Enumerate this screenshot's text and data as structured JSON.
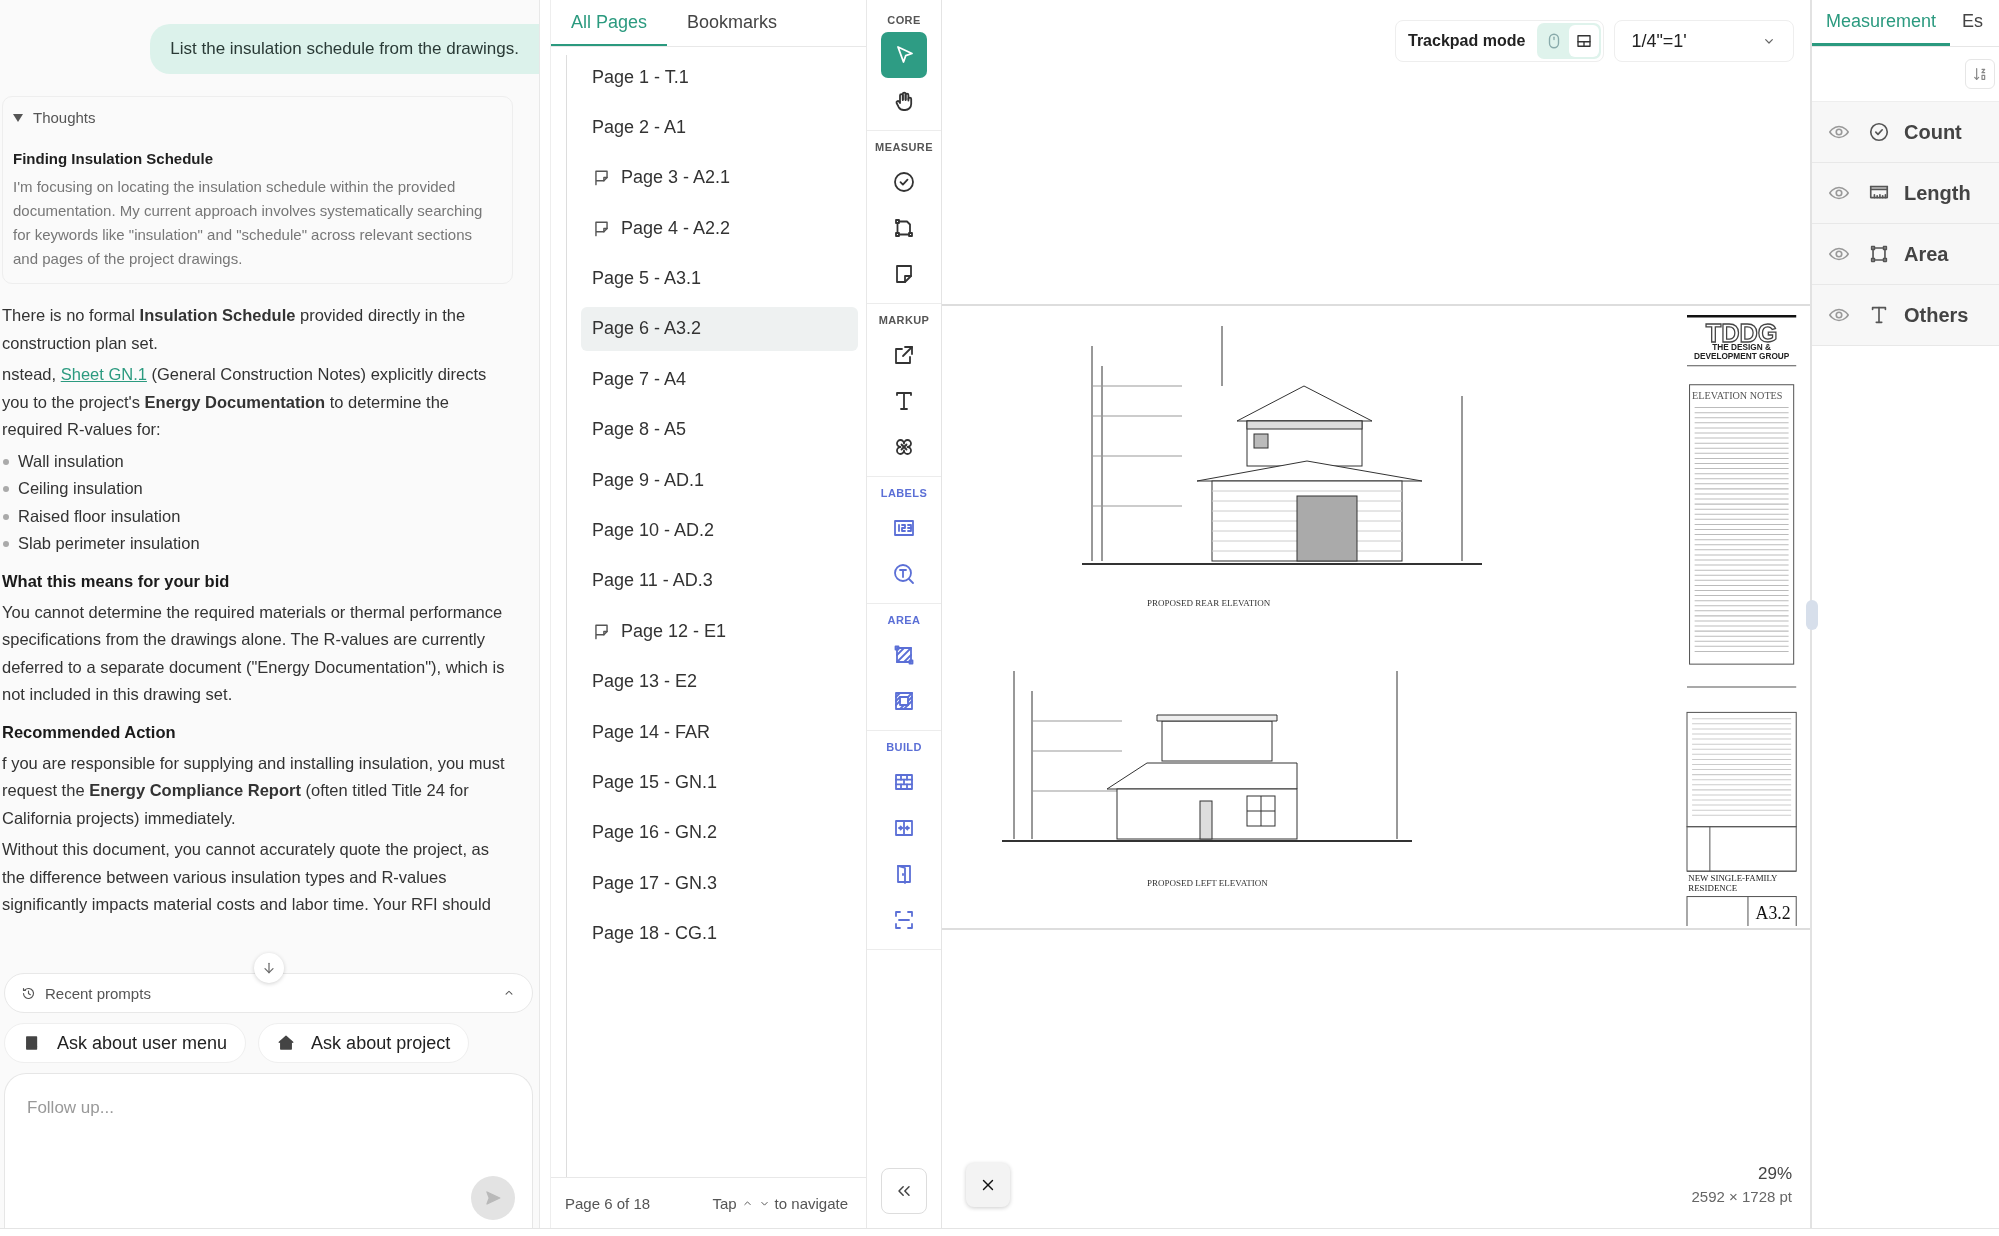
{
  "chat": {
    "user_message": "List the insulation schedule from the drawings.",
    "thoughts": {
      "label": "Thoughts",
      "expanded": true,
      "title": "Finding Insulation Schedule",
      "text": "I'm focusing on locating the insulation schedule within the provided documentation. My current approach involves systematically searching for keywords like \"insulation\" and \"schedule\" across relevant sections and pages of the project drawings."
    },
    "answer": [
      {
        "kind": "paragraph",
        "text": "There is no formal **Insulation Schedule** provided directly in the construction plan set."
      },
      {
        "kind": "link_paragraph",
        "before": "nstead, ",
        "link": "Sheet GN.1",
        "after": " (General Construction Notes) explicitly directs you to the project's **Energy Documentation** to determine the required R-values for:"
      },
      {
        "kind": "bullets",
        "items": [
          "Wall insulation",
          "Ceiling insulation",
          "Raised floor insulation",
          "Slab perimeter insulation"
        ]
      },
      {
        "kind": "heading",
        "text": "What this means for your bid"
      },
      {
        "kind": "paragraph",
        "text": "You cannot determine the required materials or thermal performance specifications from the drawings alone. The R-values are currently deferred to a separate document (\"Energy Documentation\"), which is not included in this drawing set."
      },
      {
        "kind": "heading",
        "text": "Recommended Action"
      },
      {
        "kind": "paragraph",
        "text": "f you are responsible for supplying and installing insulation, you must request the **Energy Compliance Report** (often titled Title 24 for California projects) immediately."
      },
      {
        "kind": "paragraph",
        "text": "Without this document, you cannot accurately quote the project, as the difference between various insulation types and R-values significantly impacts material costs and labor time. Your RFI should"
      }
    ],
    "recent_prompts": {
      "label": "Recent prompts",
      "expanded": false
    },
    "suggestions": [
      {
        "label": "Ask about user menu"
      },
      {
        "label": "Ask about project"
      }
    ],
    "input": {
      "placeholder": "Follow up..."
    }
  },
  "pages": {
    "tabs": [
      {
        "label": "All Pages",
        "selected": true
      },
      {
        "label": "Bookmarks",
        "selected": false
      }
    ],
    "items": [
      {
        "label": "Page 1 - T.1",
        "selected": false,
        "annotated": false
      },
      {
        "label": "Page 2 - A1",
        "selected": false,
        "annotated": false
      },
      {
        "label": "Page 3 - A2.1",
        "selected": false,
        "annotated": true
      },
      {
        "label": "Page 4 - A2.2",
        "selected": false,
        "annotated": true
      },
      {
        "label": "Page 5 - A3.1",
        "selected": false,
        "annotated": false
      },
      {
        "label": "Page 6 - A3.2",
        "selected": true,
        "annotated": false
      },
      {
        "label": "Page 7 - A4",
        "selected": false,
        "annotated": false
      },
      {
        "label": "Page 8 - A5",
        "selected": false,
        "annotated": false
      },
      {
        "label": "Page 9 - AD.1",
        "selected": false,
        "annotated": false
      },
      {
        "label": "Page 10 - AD.2",
        "selected": false,
        "annotated": false
      },
      {
        "label": "Page 11 - AD.3",
        "selected": false,
        "annotated": false
      },
      {
        "label": "Page 12 - E1",
        "selected": false,
        "annotated": true
      },
      {
        "label": "Page 13 - E2",
        "selected": false,
        "annotated": false
      },
      {
        "label": "Page 14 - FAR",
        "selected": false,
        "annotated": false
      },
      {
        "label": "Page 15 - GN.1",
        "selected": false,
        "annotated": false
      },
      {
        "label": "Page 16 - GN.2",
        "selected": false,
        "annotated": false
      },
      {
        "label": "Page 17 - GN.3",
        "selected": false,
        "annotated": false
      },
      {
        "label": "Page 18 - CG.1",
        "selected": false,
        "annotated": false
      }
    ],
    "footer": {
      "position": "Page 6 of 18",
      "hint_start": "Tap",
      "hint_end": "to navigate"
    }
  },
  "tools": [
    {
      "label": "CORE",
      "color": "#555555",
      "items": [
        {
          "selected": true
        },
        {
          "selected": false
        }
      ]
    },
    {
      "label": "MEASURE",
      "color": "#555555",
      "items": [
        {
          "selected": false
        },
        {
          "selected": false
        },
        {
          "selected": false
        }
      ]
    },
    {
      "label": "MARKUP",
      "color": "#555555",
      "items": [
        {
          "selected": false
        },
        {
          "selected": false
        },
        {
          "selected": false
        }
      ]
    },
    {
      "label": "LABELS",
      "color": "#5b6fd6",
      "items": [
        {
          "selected": false
        },
        {
          "selected": false
        }
      ]
    },
    {
      "label": "AREA",
      "color": "#5b6fd6",
      "items": [
        {
          "selected": false
        },
        {
          "selected": false
        }
      ]
    },
    {
      "label": "BUILD",
      "color": "#5b6fd6",
      "items": [
        {
          "selected": false
        },
        {
          "selected": false
        },
        {
          "selected": false
        },
        {
          "selected": false
        }
      ]
    }
  ],
  "viewer": {
    "trackpad": {
      "label": "Trackpad mode",
      "options": [
        {
          "selected": true
        },
        {
          "selected": false
        }
      ]
    },
    "scale": "1/4\"=1'",
    "sheet": {
      "rear_caption": "PROPOSED REAR ELEVATION",
      "left_caption": "PROPOSED LEFT ELEVATION",
      "logo": "TDDG",
      "firm_lines": [
        "THE DESIGN &",
        "DEVELOPMENT GROUP"
      ],
      "notes_title": "ELEVATION NOTES",
      "project_lines": [
        "NEW SINGLE-FAMILY",
        "RESIDENCE"
      ],
      "sheet_number": "A3.2"
    },
    "zoom": "29%",
    "dimensions": "2592 × 1728 pt"
  },
  "measurements": {
    "tabs": [
      {
        "label": "Measurement",
        "selected": true
      },
      {
        "label": "Es",
        "selected": false
      }
    ],
    "items": [
      {
        "label": "Count"
      },
      {
        "label": "Length"
      },
      {
        "label": "Area"
      },
      {
        "label": "Others"
      }
    ]
  }
}
